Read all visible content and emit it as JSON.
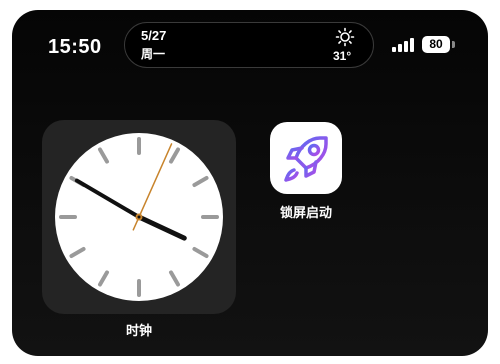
{
  "status_bar": {
    "time": "15:50",
    "battery_level": "80",
    "icons": [
      "cellular-signal-icon",
      "battery-icon"
    ]
  },
  "dynamic_island": {
    "date": "5/27",
    "weekday": "周一",
    "weather_icon": "sun-icon",
    "temperature": "31°"
  },
  "widgets": {
    "clock": {
      "label": "时钟",
      "hour": 15,
      "minute": 50,
      "second": 4
    }
  },
  "apps": [
    {
      "label": "锁屏启动",
      "icon": "rocket-icon",
      "accent": "#8a4df0"
    }
  ],
  "colors": {
    "background": "#000000",
    "second_hand": "#c8842c",
    "clock_face": "#ffffff",
    "widget_bg": "#242424"
  }
}
